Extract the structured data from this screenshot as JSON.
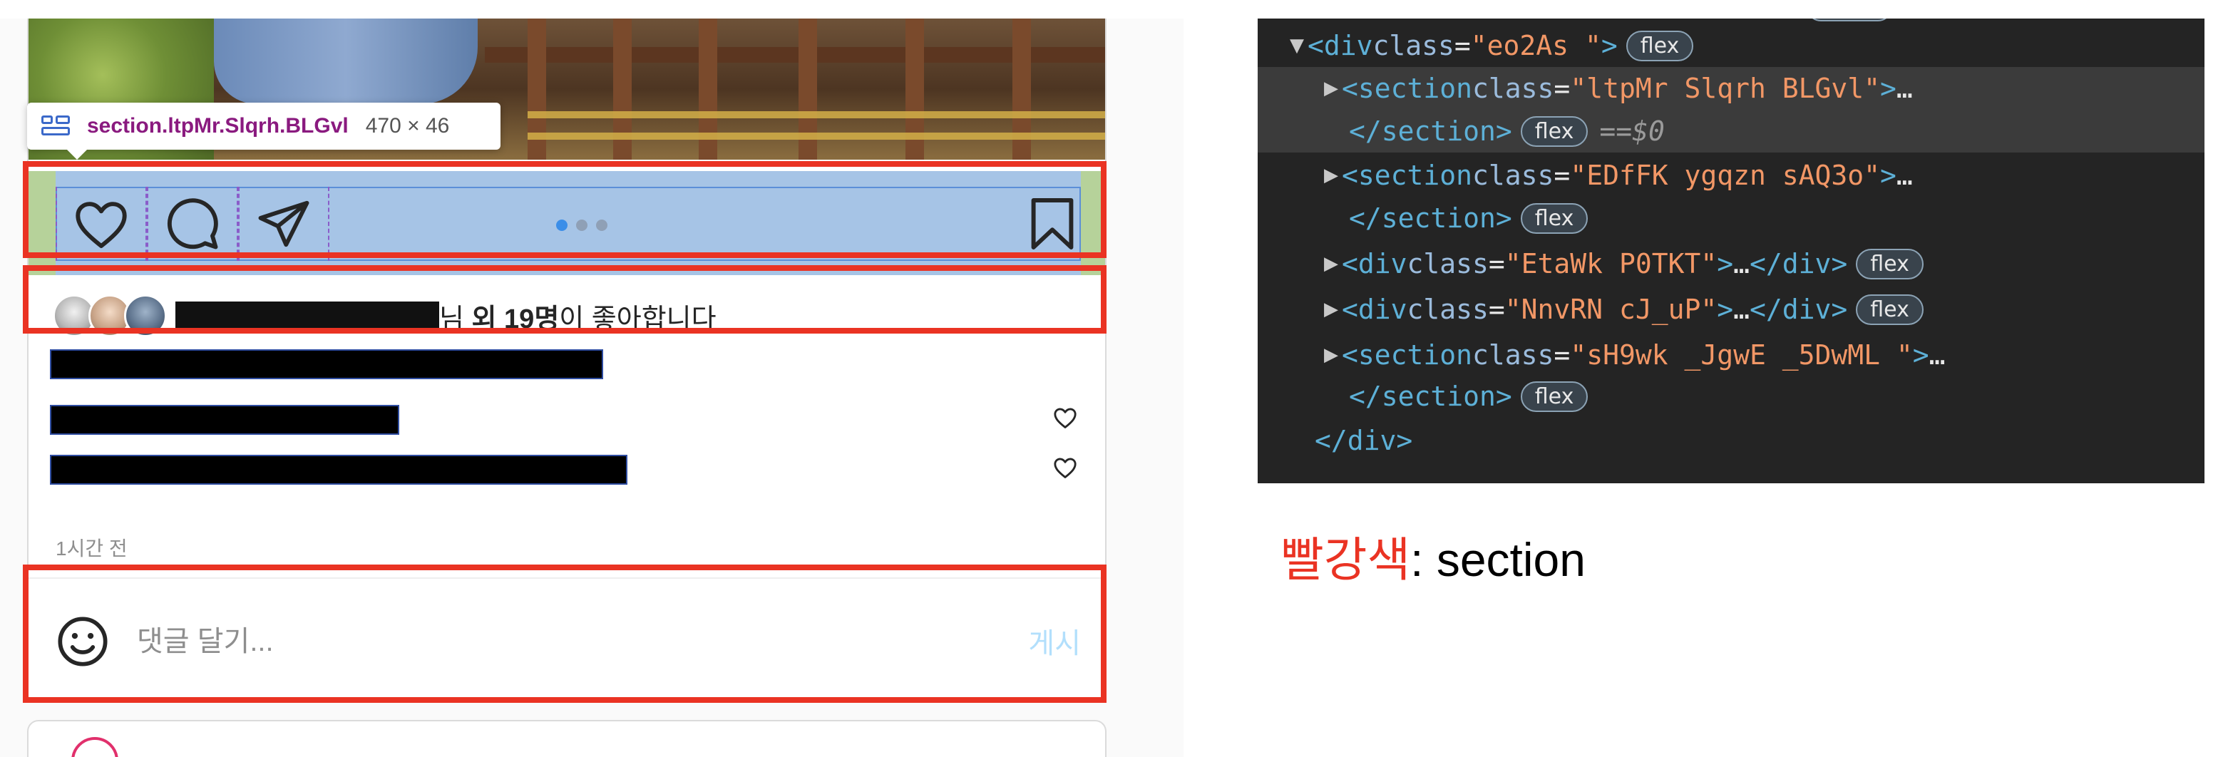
{
  "tooltip": {
    "selector": "section.ltpMr.Slqrh.BLGvl",
    "dimensions": "470 × 46"
  },
  "post": {
    "likes_suffix_pre": "님 ",
    "likes_bold": "외 19명",
    "likes_suffix_post": "이 좋아합니다",
    "time_ago": "1시간 전",
    "comment_placeholder": "댓글 달기...",
    "post_button": "게시",
    "icons": [
      "heart-icon",
      "comment-icon",
      "send-icon",
      "bookmark-icon",
      "emoji-icon"
    ],
    "carousel": {
      "count": 3,
      "active_index": 0
    }
  },
  "devtools": {
    "lines": [
      {
        "tag_open": "<div",
        "attr": "class",
        "value": "\"eo2As  \"",
        "close": ">",
        "badge": "flex"
      },
      {
        "tag_open": "<section",
        "attr": "class",
        "value": "\"ltpMr  Slqrh BLGvl\"",
        "close": ">",
        "ell": "…"
      },
      {
        "tag_close": "</section>",
        "badge": "flex",
        "eq": "==",
        "var": "$0"
      },
      {
        "tag_open": "<section",
        "attr": "class",
        "value": "\"EDfFK ygqzn sAQ3o\"",
        "close": ">",
        "ell": "…"
      },
      {
        "tag_close": "</section>",
        "badge": "flex"
      },
      {
        "tag_open": "<div",
        "attr": "class",
        "value": "\"EtaWk P0TKT\"",
        "close": ">",
        "ell": "…",
        "tag_end": "</div>",
        "badge": "flex"
      },
      {
        "tag_open": "<div",
        "attr": "class",
        "value": "\"NnvRN cJ_uP\"",
        "close": ">",
        "ell": "…",
        "tag_end": "</div>",
        "badge": "flex"
      },
      {
        "tag_open": "<section",
        "attr": "class",
        "value": "\"sH9wk  _JgwE _5DwML \"",
        "close": ">",
        "ell": "…"
      },
      {
        "tag_close": "</section>",
        "badge": "flex"
      },
      {
        "tag_close": "</div>"
      }
    ]
  },
  "legend": {
    "colored": "빨강색",
    "rest": ": section"
  },
  "colors": {
    "highlight_red": "#ea3323",
    "flex_overlay": "#a6c4e6",
    "devtools_bg": "#242424"
  }
}
